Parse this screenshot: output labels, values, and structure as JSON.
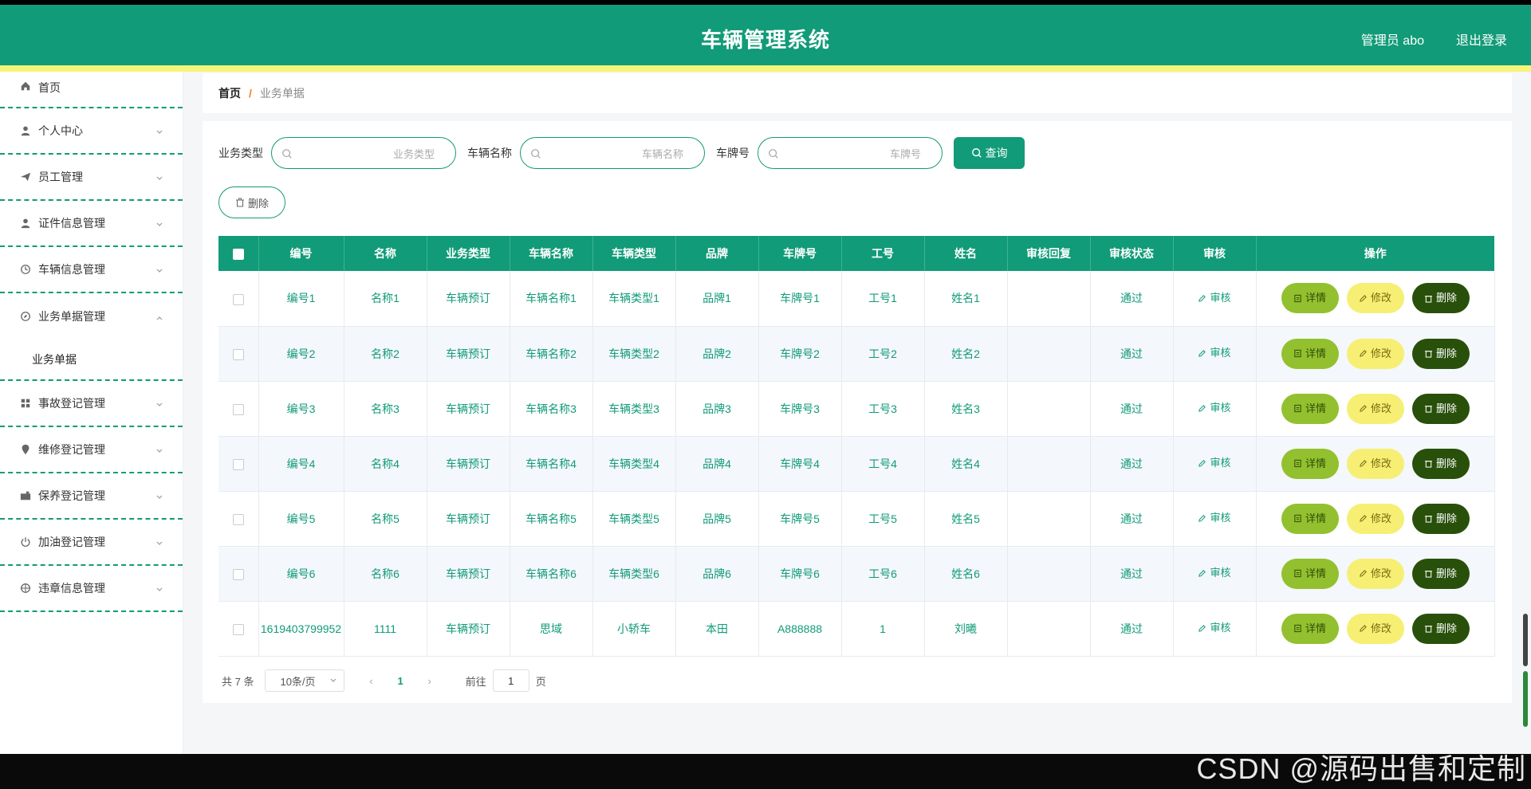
{
  "header": {
    "title": "车辆管理系统",
    "user": "管理员 abo",
    "logout": "退出登录"
  },
  "sidebar": {
    "items": [
      {
        "label": "首页",
        "icon": "home-icon"
      },
      {
        "label": "个人中心",
        "icon": "user-icon"
      },
      {
        "label": "员工管理",
        "icon": "paper-plane-icon"
      },
      {
        "label": "证件信息管理",
        "icon": "user-icon"
      },
      {
        "label": "车辆信息管理",
        "icon": "clock-icon"
      },
      {
        "label": "业务单据管理",
        "icon": "compass-icon",
        "expanded": true,
        "children": [
          "业务单据"
        ]
      },
      {
        "label": "事故登记管理",
        "icon": "grid-icon"
      },
      {
        "label": "维修登记管理",
        "icon": "location-icon"
      },
      {
        "label": "保养登记管理",
        "icon": "camera-icon"
      },
      {
        "label": "加油登记管理",
        "icon": "power-icon"
      },
      {
        "label": "违章信息管理",
        "icon": "target-icon"
      }
    ]
  },
  "breadcrumb": {
    "home": "首页",
    "separator": "/",
    "current": "业务单据"
  },
  "search": {
    "fields": [
      {
        "label": "业务类型",
        "placeholder": "业务类型"
      },
      {
        "label": "车辆名称",
        "placeholder": "车辆名称"
      },
      {
        "label": "车牌号",
        "placeholder": "车牌号"
      }
    ],
    "query_label": "查询",
    "delete_label": "删除"
  },
  "table": {
    "headers": [
      "编号",
      "名称",
      "业务类型",
      "车辆名称",
      "车辆类型",
      "品牌",
      "车牌号",
      "工号",
      "姓名",
      "审核回复",
      "审核状态",
      "审核",
      "操作"
    ],
    "rows": [
      [
        "编号1",
        "名称1",
        "车辆预订",
        "车辆名称1",
        "车辆类型1",
        "品牌1",
        "车牌号1",
        "工号1",
        "姓名1",
        "",
        "通过"
      ],
      [
        "编号2",
        "名称2",
        "车辆预订",
        "车辆名称2",
        "车辆类型2",
        "品牌2",
        "车牌号2",
        "工号2",
        "姓名2",
        "",
        "通过"
      ],
      [
        "编号3",
        "名称3",
        "车辆预订",
        "车辆名称3",
        "车辆类型3",
        "品牌3",
        "车牌号3",
        "工号3",
        "姓名3",
        "",
        "通过"
      ],
      [
        "编号4",
        "名称4",
        "车辆预订",
        "车辆名称4",
        "车辆类型4",
        "品牌4",
        "车牌号4",
        "工号4",
        "姓名4",
        "",
        "通过"
      ],
      [
        "编号5",
        "名称5",
        "车辆预订",
        "车辆名称5",
        "车辆类型5",
        "品牌5",
        "车牌号5",
        "工号5",
        "姓名5",
        "",
        "通过"
      ],
      [
        "编号6",
        "名称6",
        "车辆预订",
        "车辆名称6",
        "车辆类型6",
        "品牌6",
        "车牌号6",
        "工号6",
        "姓名6",
        "",
        "通过"
      ],
      [
        "1619403799952",
        "1111",
        "车辆预订",
        "思域",
        "小轿车",
        "本田",
        "A888888",
        "1",
        "刘曦",
        "",
        "通过"
      ]
    ],
    "audit_label": "审核",
    "ops": {
      "detail": "详情",
      "edit": "修改",
      "delete": "删除"
    }
  },
  "pager": {
    "total": "共 7 条",
    "page_size": "10条/页",
    "prev": "‹",
    "page": "1",
    "next": "›",
    "goto_prefix": "前往",
    "goto_value": "1",
    "goto_suffix": "页"
  },
  "watermark": "CSDN @源码出售和定制",
  "colors": {
    "primary": "#119b78",
    "accent_yellow": "#f6f57a",
    "detail_btn": "#93c02e",
    "edit_btn": "#f6ef73",
    "delete_btn": "#28500a"
  }
}
